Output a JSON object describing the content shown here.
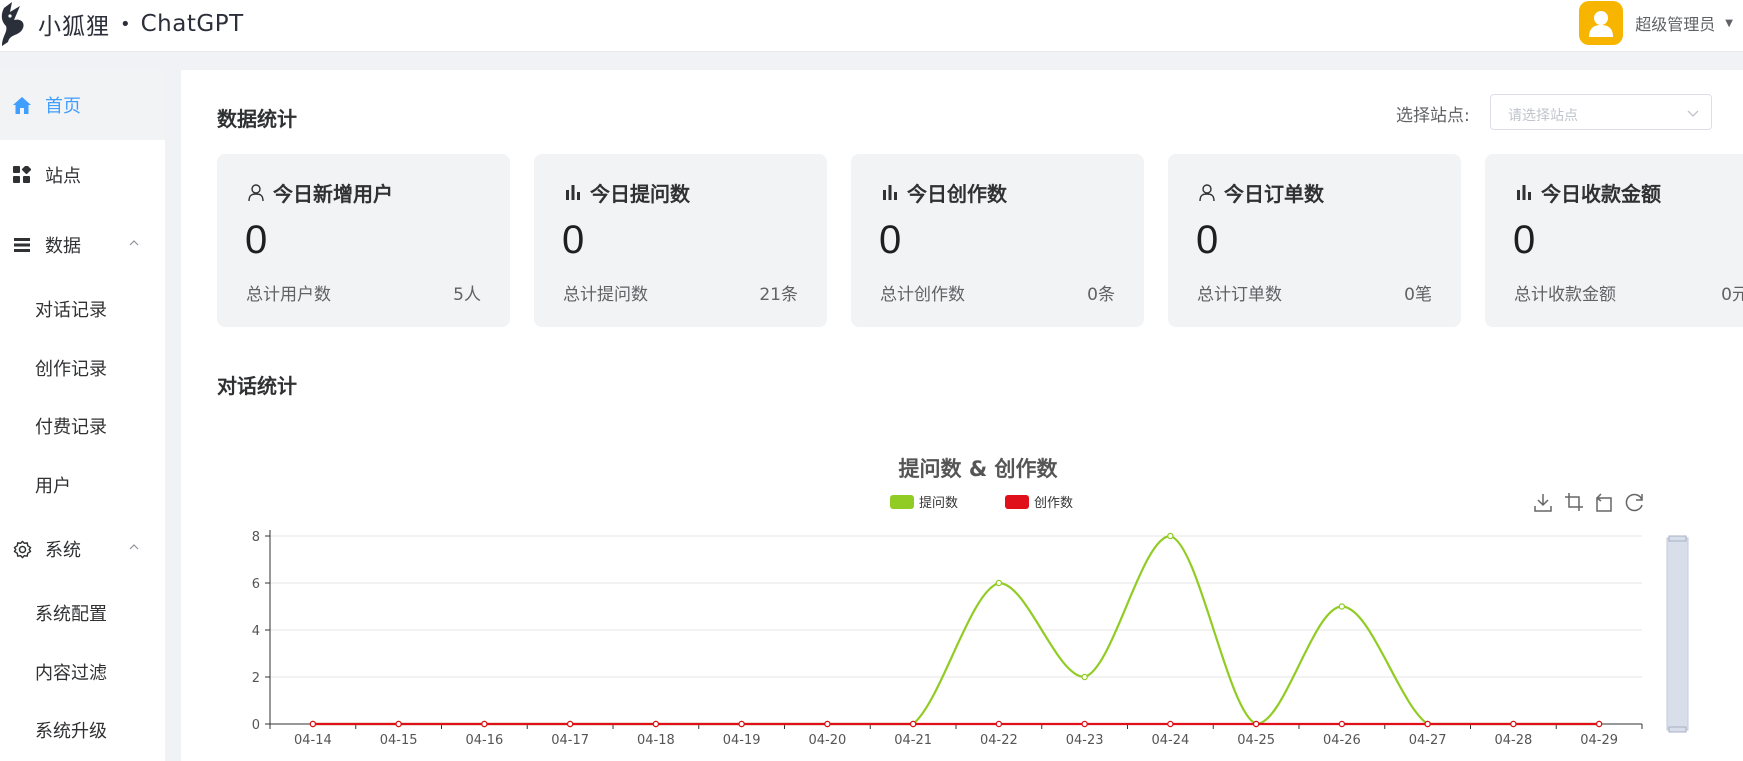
{
  "header": {
    "logo_text": "小狐狸",
    "logo_sep": "•",
    "brand": "ChatGPT",
    "user_name": "超级管理员",
    "colors": {
      "avatar_bg": "#f7b500"
    }
  },
  "sidebar": {
    "items": [
      {
        "label": "首页",
        "icon": "home-icon",
        "active": true
      },
      {
        "label": "站点",
        "icon": "grid-icon"
      },
      {
        "label": "数据",
        "icon": "list-icon",
        "expanded": true,
        "children": [
          "对话记录",
          "创作记录",
          "付费记录",
          "用户"
        ]
      },
      {
        "label": "系统",
        "icon": "gear-icon",
        "expanded": true,
        "children": [
          "系统配置",
          "内容过滤",
          "系统升级"
        ]
      }
    ]
  },
  "main": {
    "stats_title": "数据统计",
    "site_select": {
      "label": "选择站点:",
      "placeholder": "请选择站点"
    },
    "cards": [
      {
        "title": "今日新增用户",
        "icon": "user-icon",
        "value": "0",
        "foot_label": "总计用户数",
        "foot_value": "5人"
      },
      {
        "title": "今日提问数",
        "icon": "bar-chart-icon",
        "value": "0",
        "foot_label": "总计提问数",
        "foot_value": "21条"
      },
      {
        "title": "今日创作数",
        "icon": "bar-chart-icon",
        "value": "0",
        "foot_label": "总计创作数",
        "foot_value": "0条"
      },
      {
        "title": "今日订单数",
        "icon": "user-icon",
        "value": "0",
        "foot_label": "总计订单数",
        "foot_value": "0笔"
      },
      {
        "title": "今日收款金额",
        "icon": "bar-chart-icon",
        "value": "0",
        "foot_label": "总计收款金额",
        "foot_value": "0元"
      }
    ],
    "chat_title": "对话统计"
  },
  "chart_data": {
    "type": "line",
    "title": "提问数 & 创作数",
    "categories": [
      "04-14",
      "04-15",
      "04-16",
      "04-17",
      "04-18",
      "04-19",
      "04-20",
      "04-21",
      "04-22",
      "04-23",
      "04-24",
      "04-25",
      "04-26",
      "04-27",
      "04-28",
      "04-29"
    ],
    "series": [
      {
        "name": "提问数",
        "color": "#91cc24",
        "values": [
          0,
          0,
          0,
          0,
          0,
          0,
          0,
          0,
          6,
          2,
          8,
          0,
          5,
          0,
          0,
          0
        ]
      },
      {
        "name": "创作数",
        "color": "#e0101a",
        "values": [
          0,
          0,
          0,
          0,
          0,
          0,
          0,
          0,
          0,
          0,
          0,
          0,
          0,
          0,
          0,
          0
        ]
      }
    ],
    "ylim": [
      0,
      8
    ],
    "yticks": [
      0,
      2,
      4,
      6,
      8
    ],
    "grid": true,
    "legend": "top-center",
    "toolbox": [
      "download-icon",
      "crop-icon",
      "crop-reset-icon",
      "refresh-icon"
    ]
  }
}
